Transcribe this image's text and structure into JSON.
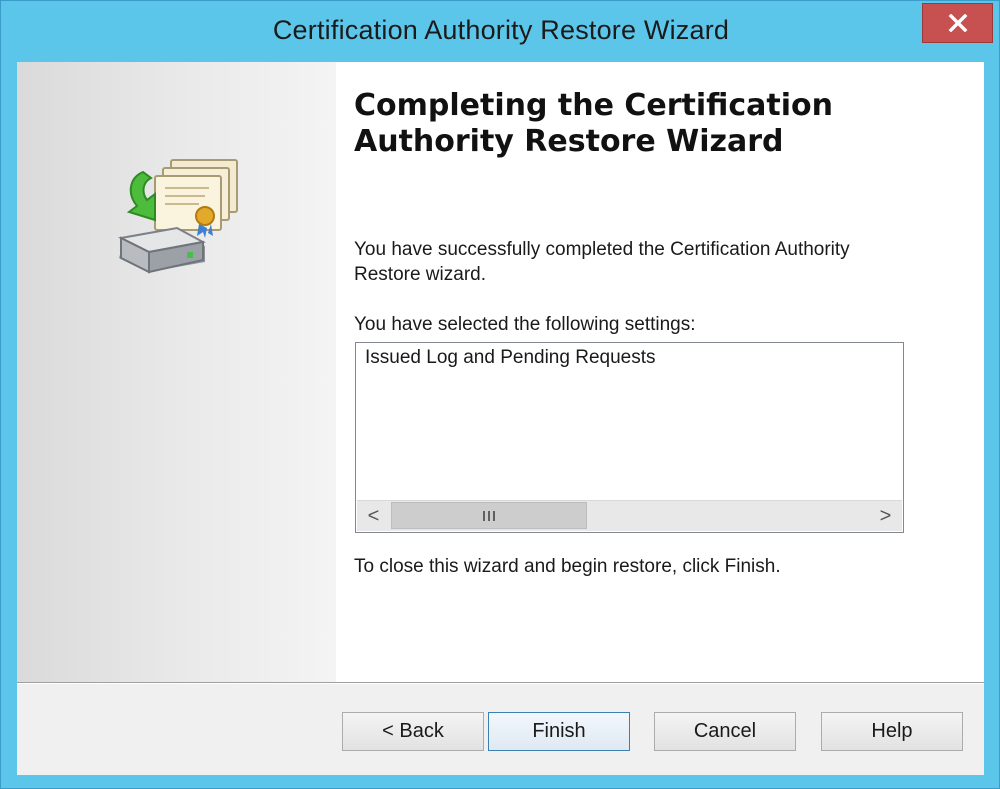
{
  "window": {
    "title": "Certification Authority Restore Wizard",
    "close_icon": "close-icon",
    "accent_color": "#5cc6ea",
    "close_color": "#c75050"
  },
  "page": {
    "heading": "Completing the Certification Authority Restore Wizard",
    "intro": "You have successfully completed the Certification Authority Restore wizard.",
    "settings_label": "You have selected the following settings:",
    "settings": [
      "Issued Log and Pending Requests"
    ],
    "scroll_left_glyph": "<",
    "scroll_right_glyph": ">",
    "closing_note": "To close this wizard and begin restore, click Finish.",
    "icon": "certificate-restore-icon"
  },
  "buttons": {
    "back": "< Back",
    "finish": "Finish",
    "cancel": "Cancel",
    "help": "Help"
  }
}
